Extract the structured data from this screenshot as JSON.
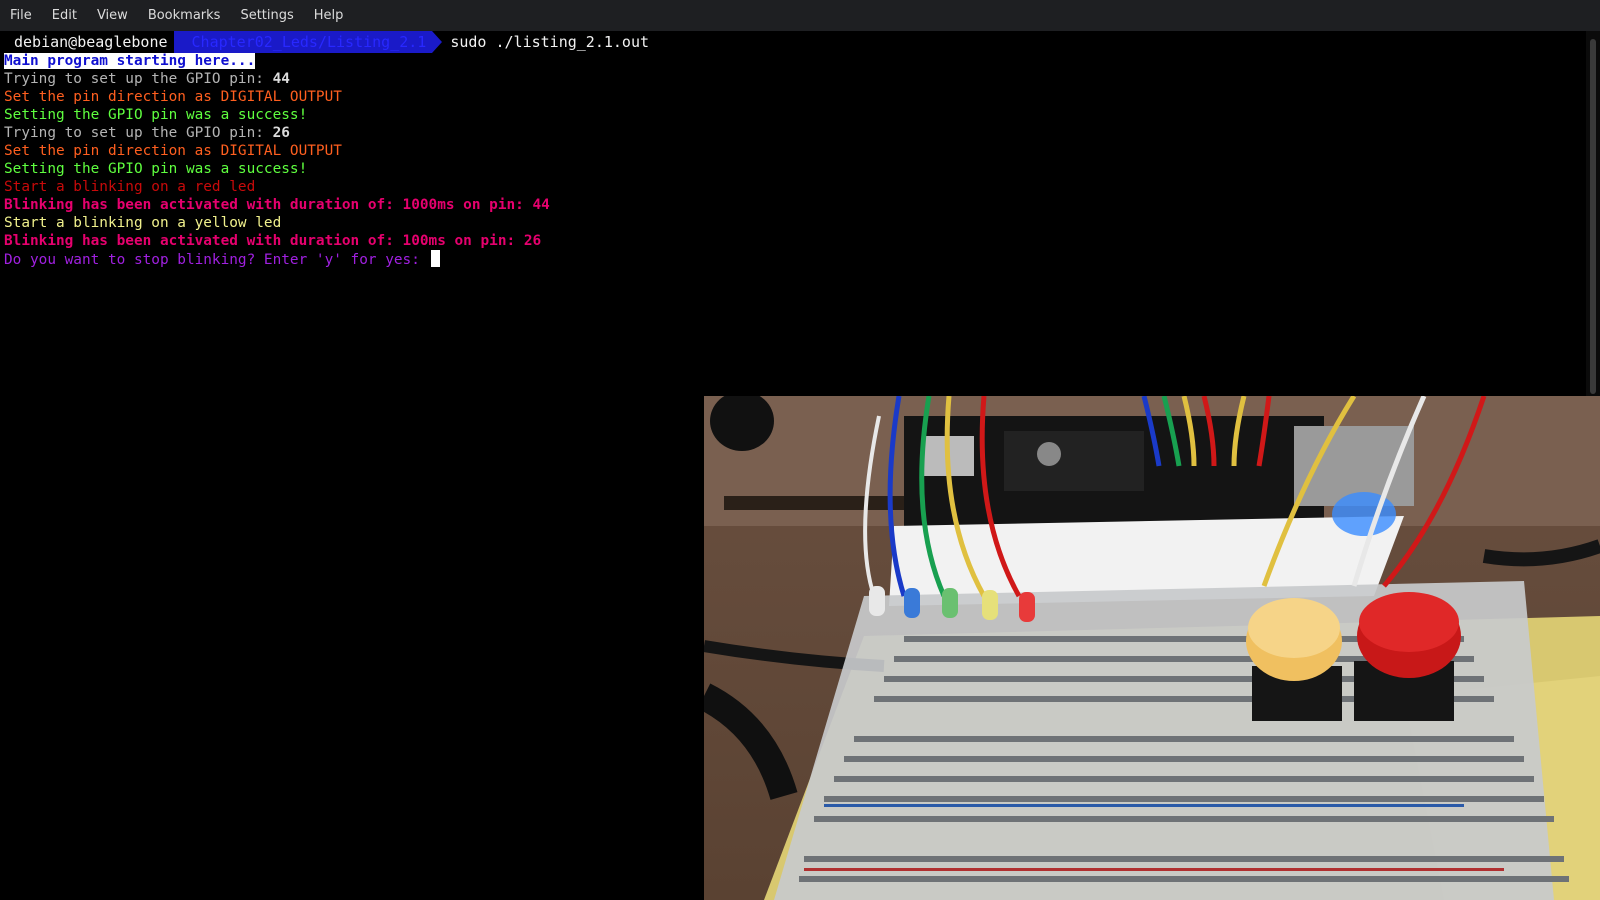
{
  "menubar": {
    "items": [
      "File",
      "Edit",
      "View",
      "Bookmarks",
      "Settings",
      "Help"
    ]
  },
  "terminal": {
    "prompt": {
      "user": "debian@beaglebone",
      "path": "Chapter02_Leds/Listing_2.1",
      "command": "sudo ./listing_2.1.out"
    },
    "lines": {
      "l1": "Main program starting here...",
      "l2_text": "Trying to set up the GPIO pin: ",
      "l2_pin": "44",
      "l3": "Set the pin direction as DIGITAL OUTPUT",
      "l4": "Setting the GPIO pin was a success!",
      "l5_text": "Trying to set up the GPIO pin: ",
      "l5_pin": "26",
      "l6": "Set the pin direction as DIGITAL OUTPUT",
      "l7": "Setting the GPIO pin was a success!",
      "l8": "Start a blinking on a red led",
      "l9": "Blinking has been activated with duration of: 1000ms on pin: 44",
      "l10": "Start a blinking on a yellow led",
      "l11": "Blinking has been activated with duration of: 100ms on pin: 26",
      "l12": "Do you want to stop blinking? Enter 'y' for yes: "
    }
  },
  "colors": {
    "terminal_bg": "#000000",
    "menubar_bg": "#1e1f22",
    "prompt_path_bg": "#1a1ac8",
    "setup_text": "#b4b4b4",
    "direction_text": "#ff5f1f",
    "success_text": "#5fff3f",
    "red_led_text": "#c80a0a",
    "blink_active_text": "#e6006e",
    "yellow_led_text": "#f0f08c",
    "question_text": "#a020e0"
  },
  "camera_overlay": {
    "scene": "breadboard with LEDs and push buttons connected to BeagleBone"
  }
}
